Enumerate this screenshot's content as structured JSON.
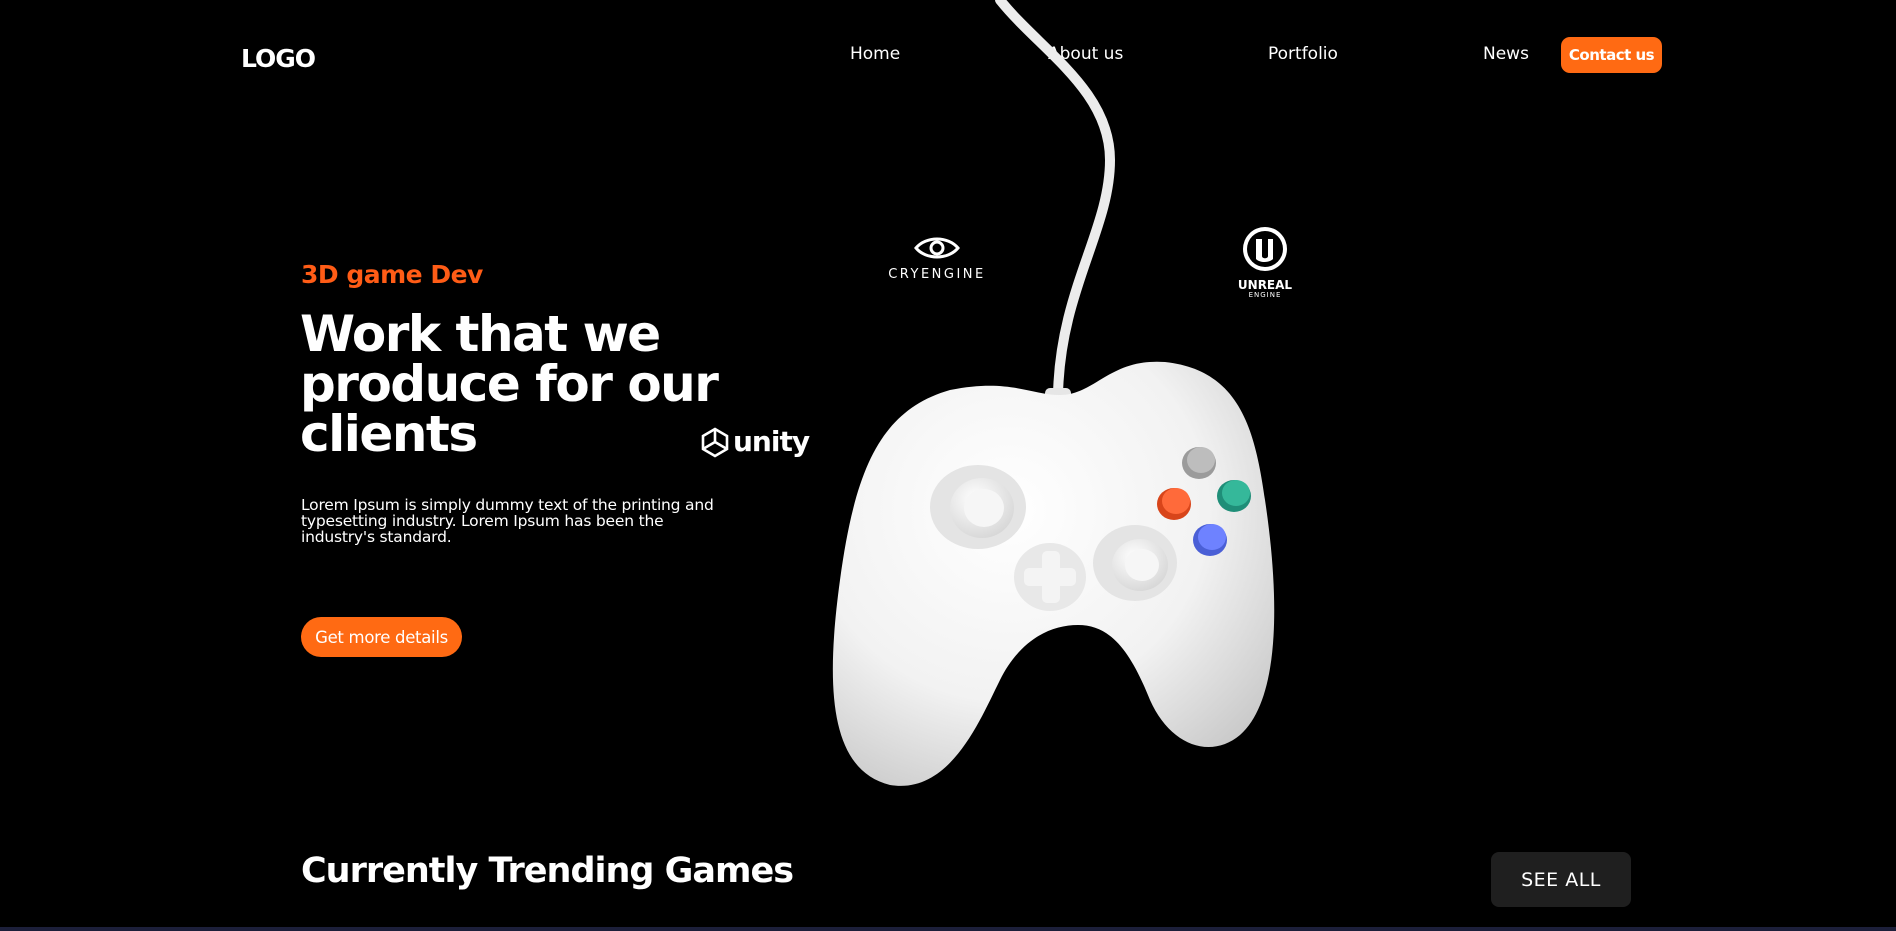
{
  "header": {
    "logo": "LOGO",
    "nav": [
      {
        "label": "Home"
      },
      {
        "label": "About us"
      },
      {
        "label": "Portfolio"
      },
      {
        "label": "News"
      }
    ],
    "contact_label": "Contact us"
  },
  "hero": {
    "kicker": "3D game Dev",
    "title": "Work that we produce for our clients",
    "description": "Lorem Ipsum is simply dummy text of the printing and typesetting industry. Lorem Ipsum has been the industry's standard.",
    "cta_label": "Get more details"
  },
  "engines": {
    "unity": "unity",
    "cryengine": "CRYENGINE",
    "unreal": "UNREAL",
    "unreal_sub": "ENGINE"
  },
  "trending": {
    "title": "Currently Trending Games",
    "see_all_label": "SEE ALL"
  },
  "colors": {
    "accent": "#ff6a13",
    "background": "#000000",
    "button_dark": "#1f1f1f"
  },
  "icons": [
    "unity-logo-icon",
    "cryengine-eye-icon",
    "unreal-engine-icon",
    "game-controller-image"
  ]
}
